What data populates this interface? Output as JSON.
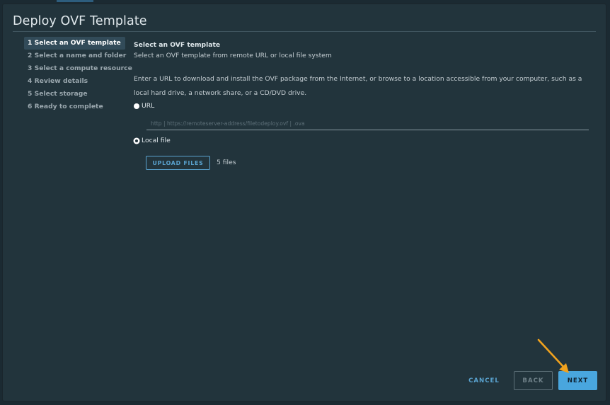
{
  "dialog": {
    "title": "Deploy OVF Template"
  },
  "steps": [
    {
      "label": "1 Select an OVF template",
      "active": true
    },
    {
      "label": "2 Select a name and folder",
      "active": false
    },
    {
      "label": "3 Select a compute resource",
      "active": false
    },
    {
      "label": "4 Review details",
      "active": false
    },
    {
      "label": "5 Select storage",
      "active": false
    },
    {
      "label": "6 Ready to complete",
      "active": false
    }
  ],
  "content": {
    "section_title": "Select an OVF template",
    "section_subtitle": "Select an OVF template from remote URL or local file system",
    "description": "Enter a URL to download and install the OVF package from the Internet, or browse to a location accessible from your computer, such as a local hard drive, a network share, or a CD/DVD drive.",
    "url_option_label": "URL",
    "url_placeholder": "http | https://remoteserver-address/filetodeploy.ovf | .ova",
    "url_value": "",
    "local_option_label": "Local file",
    "selected_option": "Local file",
    "upload_label": "UPLOAD FILES",
    "file_count": "5 files"
  },
  "footer": {
    "cancel_label": "CANCEL",
    "back_label": "BACK",
    "next_label": "NEXT"
  },
  "colors": {
    "accent": "#49a6de",
    "annotation_arrow": "#f0a21e"
  }
}
